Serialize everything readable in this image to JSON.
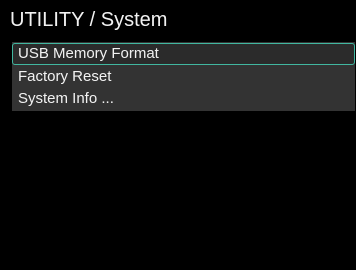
{
  "header": {
    "title": "UTILITY / System"
  },
  "menu": {
    "selected_index": 0,
    "items": [
      {
        "label": "USB Memory Format"
      },
      {
        "label": "Factory Reset"
      },
      {
        "label": "System Info ..."
      }
    ]
  },
  "colors": {
    "background": "#000000",
    "menu_background": "#333333",
    "selection_outline": "#41b7a0",
    "text": "#f2f2f2"
  }
}
